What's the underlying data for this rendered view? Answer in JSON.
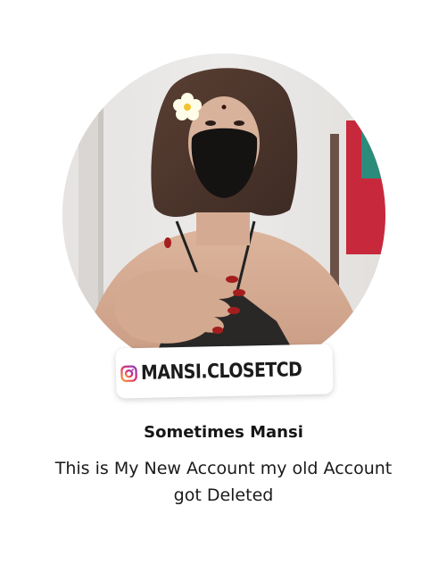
{
  "profile": {
    "photo_description": "profile-photo",
    "handle": "MANSI.CLOSETCD",
    "handle_icon": "instagram-icon",
    "display_name": "Sometimes Mansi",
    "bio_line_1": "This is My New Account my old Account",
    "bio_line_2": "got Deleted"
  },
  "colors": {
    "background": "#ffffff",
    "text": "#111111",
    "instagram_gradient_start": "#f9a23b",
    "instagram_gradient_mid": "#e1306c",
    "instagram_gradient_end": "#8a3ab9"
  }
}
